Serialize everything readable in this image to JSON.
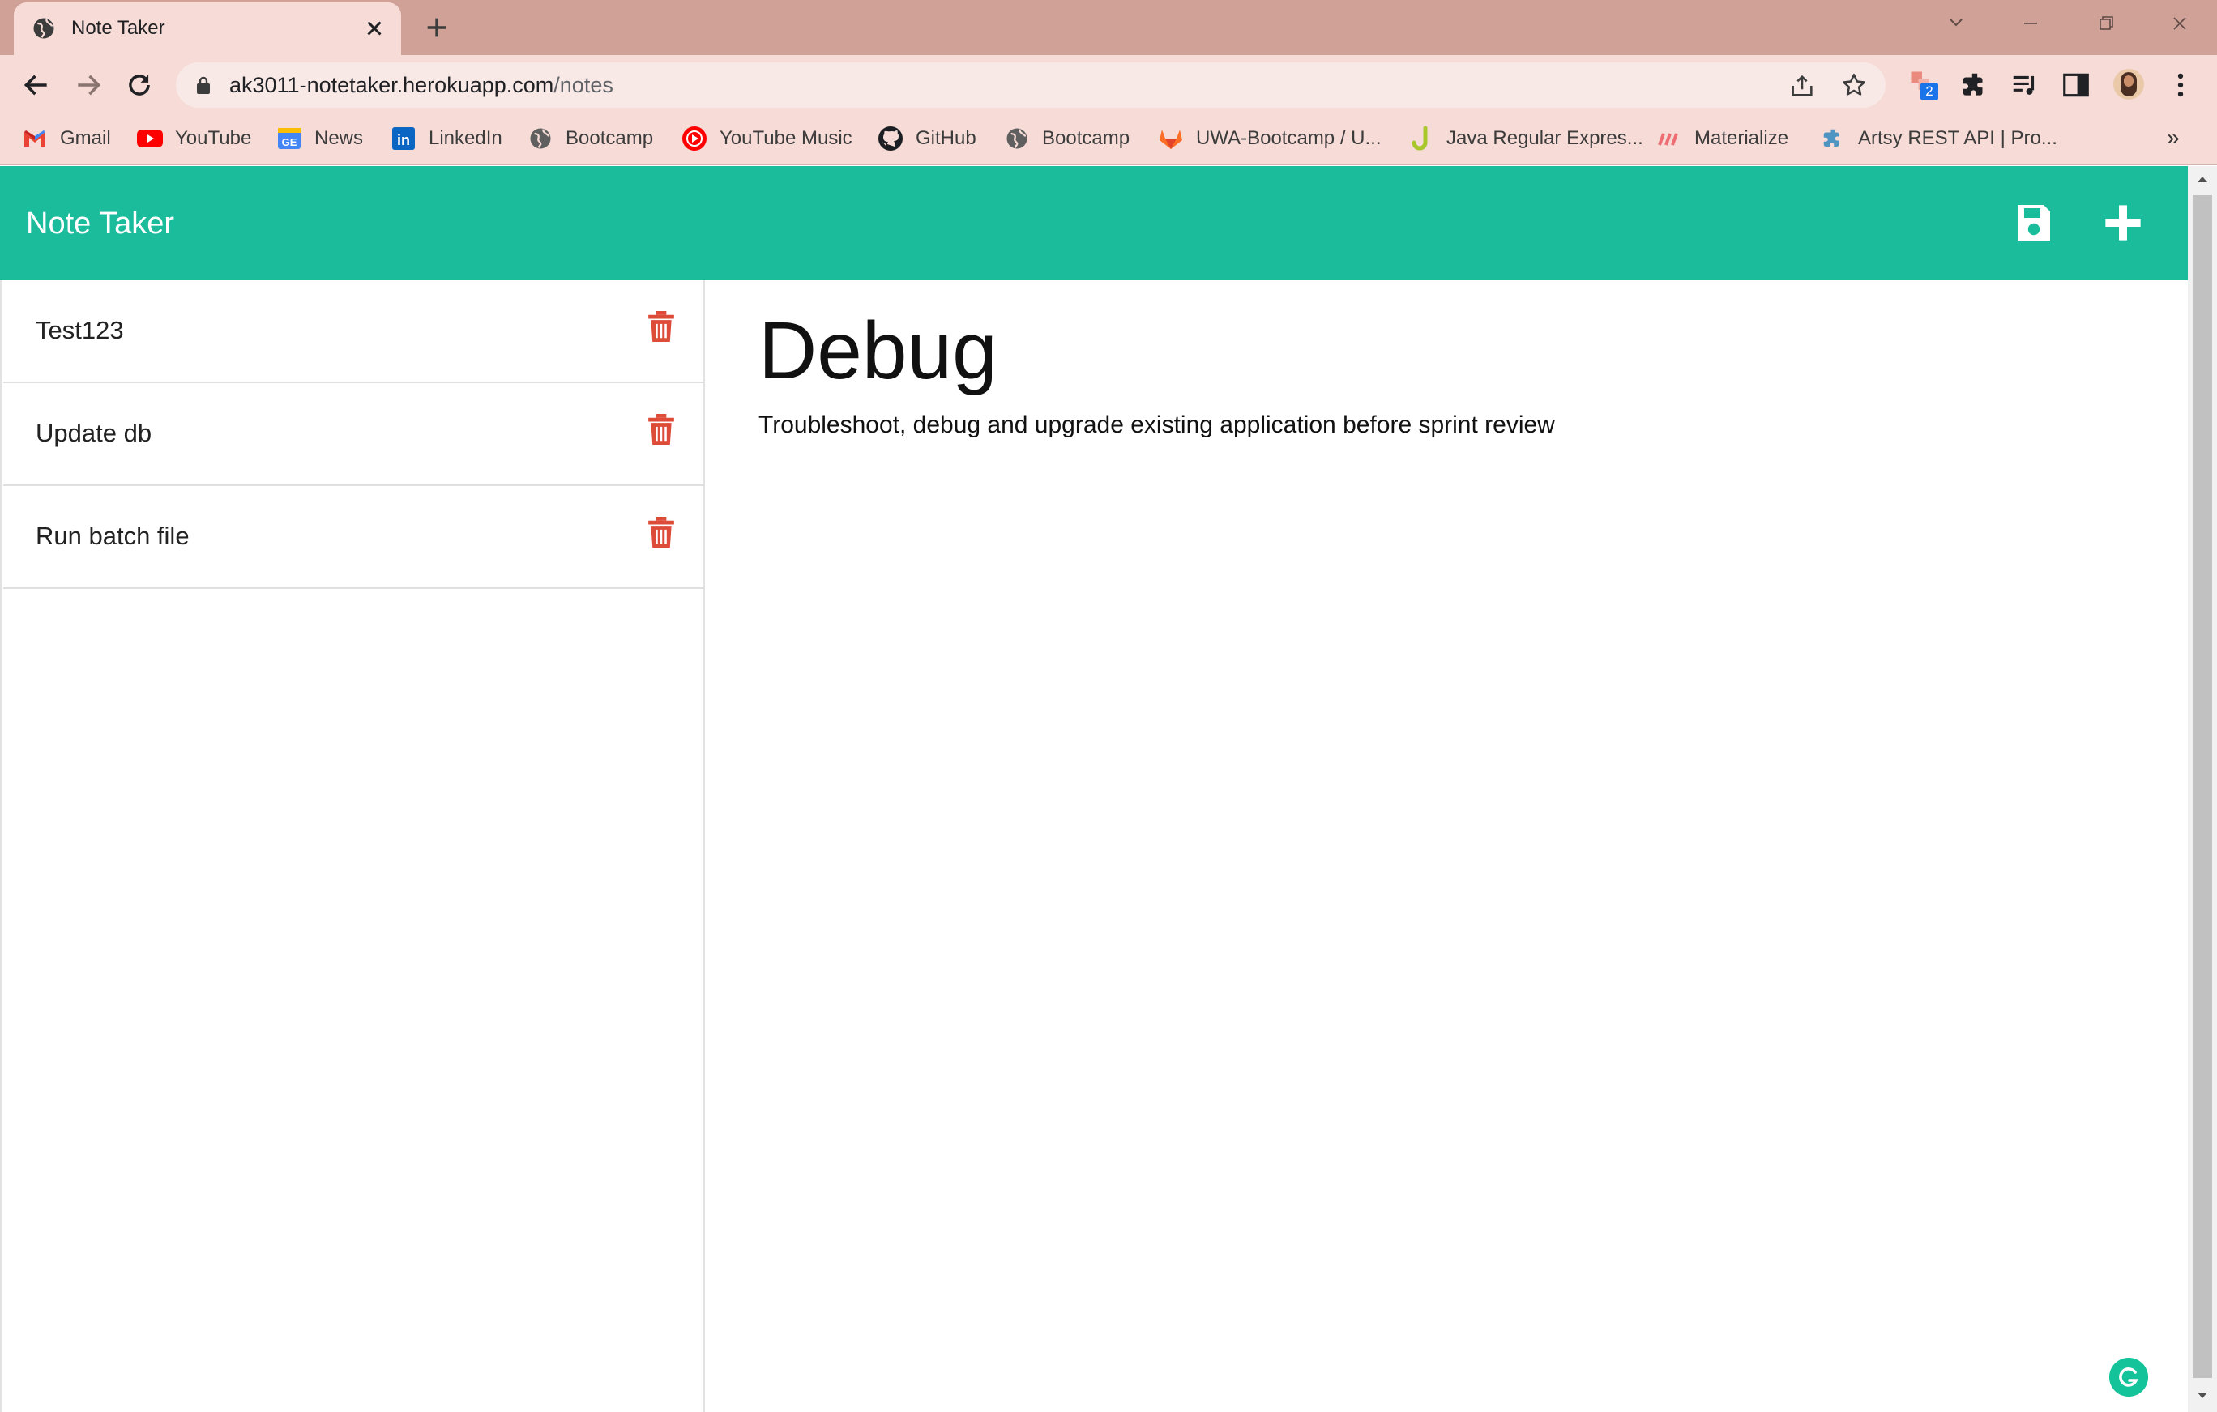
{
  "browser": {
    "tab": {
      "title": "Note Taker"
    },
    "url": {
      "host": "ak3011-notetaker.herokuapp.com",
      "path": "/notes"
    },
    "extension_badge": "2",
    "bookmarks": [
      {
        "label": "Gmail",
        "icon": "gmail-icon"
      },
      {
        "label": "YouTube",
        "icon": "youtube-icon"
      },
      {
        "label": "News",
        "icon": "google-news-icon"
      },
      {
        "label": "LinkedIn",
        "icon": "linkedin-icon"
      },
      {
        "label": "Bootcamp",
        "icon": "globe-icon"
      },
      {
        "label": "YouTube Music",
        "icon": "youtube-music-icon"
      },
      {
        "label": "GitHub",
        "icon": "github-icon"
      },
      {
        "label": "Bootcamp",
        "icon": "globe-icon"
      },
      {
        "label": "UWA-Bootcamp / U...",
        "icon": "gitlab-icon"
      },
      {
        "label": "Java Regular Expres...",
        "icon": "j-icon"
      },
      {
        "label": "Materialize",
        "icon": "materialize-icon"
      },
      {
        "label": "Artsy REST API | Pro...",
        "icon": "puzzle-icon"
      }
    ],
    "bookmarks_more": "»"
  },
  "app": {
    "brand": "Note Taker",
    "notes": [
      {
        "title": "Test123"
      },
      {
        "title": "Update db"
      },
      {
        "title": "Run batch file"
      }
    ],
    "active_note": {
      "title": "Debug",
      "text": "Troubleshoot, debug and upgrade existing application before sprint review"
    }
  },
  "colors": {
    "navbar": "#1abc9c",
    "trash": "#dd4b39",
    "tabbar": "#d0a197",
    "toolbar": "#f6dbd6"
  }
}
